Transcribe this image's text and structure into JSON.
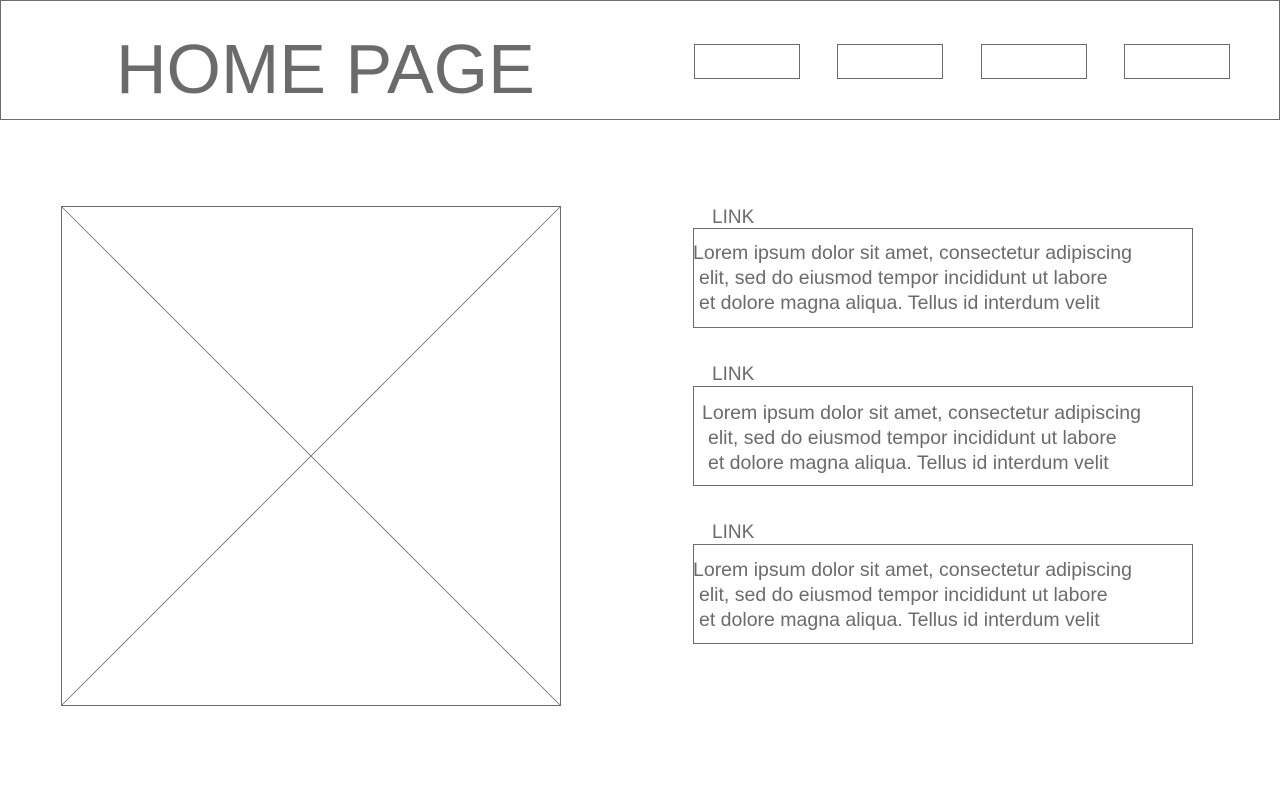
{
  "header": {
    "title": "HOME PAGE",
    "nav_buttons": [
      "",
      "",
      "",
      ""
    ]
  },
  "sections": [
    {
      "link": "LINK",
      "lines": [
        "Lorem ipsum dolor sit amet, consectetur adipiscing",
        "elit, sed do eiusmod tempor incididunt ut labore",
        "et dolore magna aliqua. Tellus id interdum velit"
      ]
    },
    {
      "link": "LINK",
      "lines": [
        "Lorem ipsum dolor sit amet, consectetur adipiscing",
        "elit, sed do eiusmod tempor incididunt ut labore",
        "et dolore magna aliqua. Tellus id interdum velit"
      ]
    },
    {
      "link": "LINK",
      "lines": [
        "Lorem ipsum dolor sit amet, consectetur adipiscing",
        "elit, sed do eiusmod tempor incididunt ut labore",
        "et dolore magna aliqua. Tellus id interdum velit"
      ]
    }
  ],
  "colors": {
    "stroke": "#6b6b6b",
    "text": "#6b6b6b",
    "background": "#ffffff"
  }
}
